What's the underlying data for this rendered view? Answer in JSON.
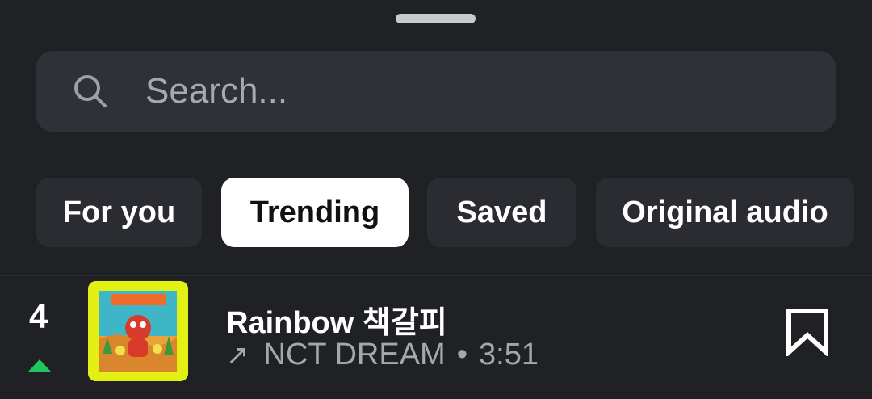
{
  "search": {
    "placeholder": "Search..."
  },
  "tabs": [
    {
      "label": "For you",
      "active": false
    },
    {
      "label": "Trending",
      "active": true
    },
    {
      "label": "Saved",
      "active": false
    },
    {
      "label": "Original audio",
      "active": false
    }
  ],
  "track": {
    "rank": "4",
    "trend": "up",
    "title": "Rainbow 책갈피",
    "artist": "NCT DREAM",
    "separator": "•",
    "duration": "3:51",
    "artwork": "album-cover"
  },
  "icons": {
    "search": "search-icon",
    "trend": "trend-arrow-icon",
    "bookmark": "bookmark-icon",
    "rank_change": "rank-up-icon"
  },
  "colors": {
    "background": "#202125",
    "search_bg": "#2e3138",
    "chip_bg": "#2a2c32",
    "chip_active_bg": "#ffffff",
    "rank_up": "#22c55e",
    "muted_text": "#a5a7ab"
  }
}
